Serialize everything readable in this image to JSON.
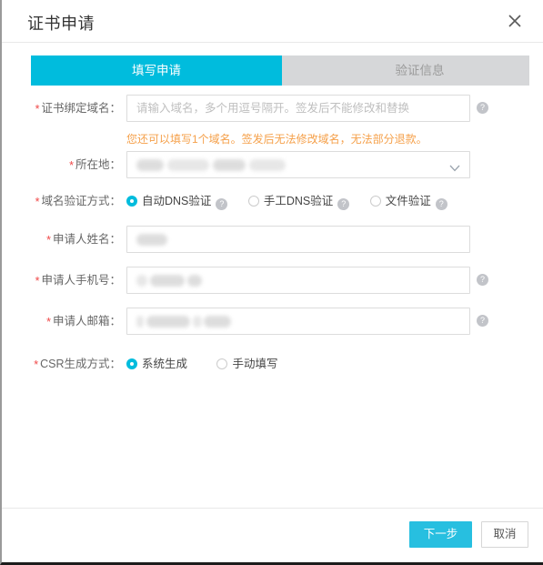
{
  "dialog": {
    "title": "证书申请",
    "close_icon": "close-icon"
  },
  "steps": [
    {
      "label": "填写申请",
      "state": "active"
    },
    {
      "label": "验证信息",
      "state": "inactive"
    }
  ],
  "form": {
    "domain": {
      "label": "证书绑定域名：",
      "required": "*",
      "value": "",
      "placeholder": "请输入域名，多个用逗号隔开。签发后不能修改和替换",
      "help": "?"
    },
    "warning": "您还可以填写1个域名。签发后无法修改域名，无法部分退款。",
    "location": {
      "label": "所在地：",
      "required": "*",
      "value": "",
      "chevron": "chevron-down-icon"
    },
    "verify_method": {
      "label": "域名验证方式：",
      "required": "*",
      "options": [
        {
          "label": "自动DNS验证",
          "selected": true,
          "help": "?"
        },
        {
          "label": "手工DNS验证",
          "selected": false,
          "help": "?"
        },
        {
          "label": "文件验证",
          "selected": false,
          "help": "?"
        }
      ]
    },
    "applicant_name": {
      "label": "申请人姓名：",
      "required": "*",
      "value": "",
      "placeholder": ""
    },
    "applicant_phone": {
      "label": "申请人手机号：",
      "required": "*",
      "value": "",
      "placeholder": "",
      "help": "?"
    },
    "applicant_email": {
      "label": "申请人邮箱：",
      "required": "*",
      "value": "",
      "placeholder": "",
      "help": "?"
    },
    "csr_method": {
      "label": "CSR生成方式：",
      "required": "*",
      "options": [
        {
          "label": "系统生成",
          "selected": true
        },
        {
          "label": "手动填写",
          "selected": false
        }
      ]
    }
  },
  "footer": {
    "next_label": "下一步",
    "cancel_label": "取消"
  },
  "colors": {
    "accent": "#00bcdd",
    "primary_button": "#27bfe0",
    "warning": "#f5a04a",
    "required": "#f04848",
    "step_inactive_bg": "#d6d7d9",
    "step_inactive_text": "#9b9b9b"
  }
}
